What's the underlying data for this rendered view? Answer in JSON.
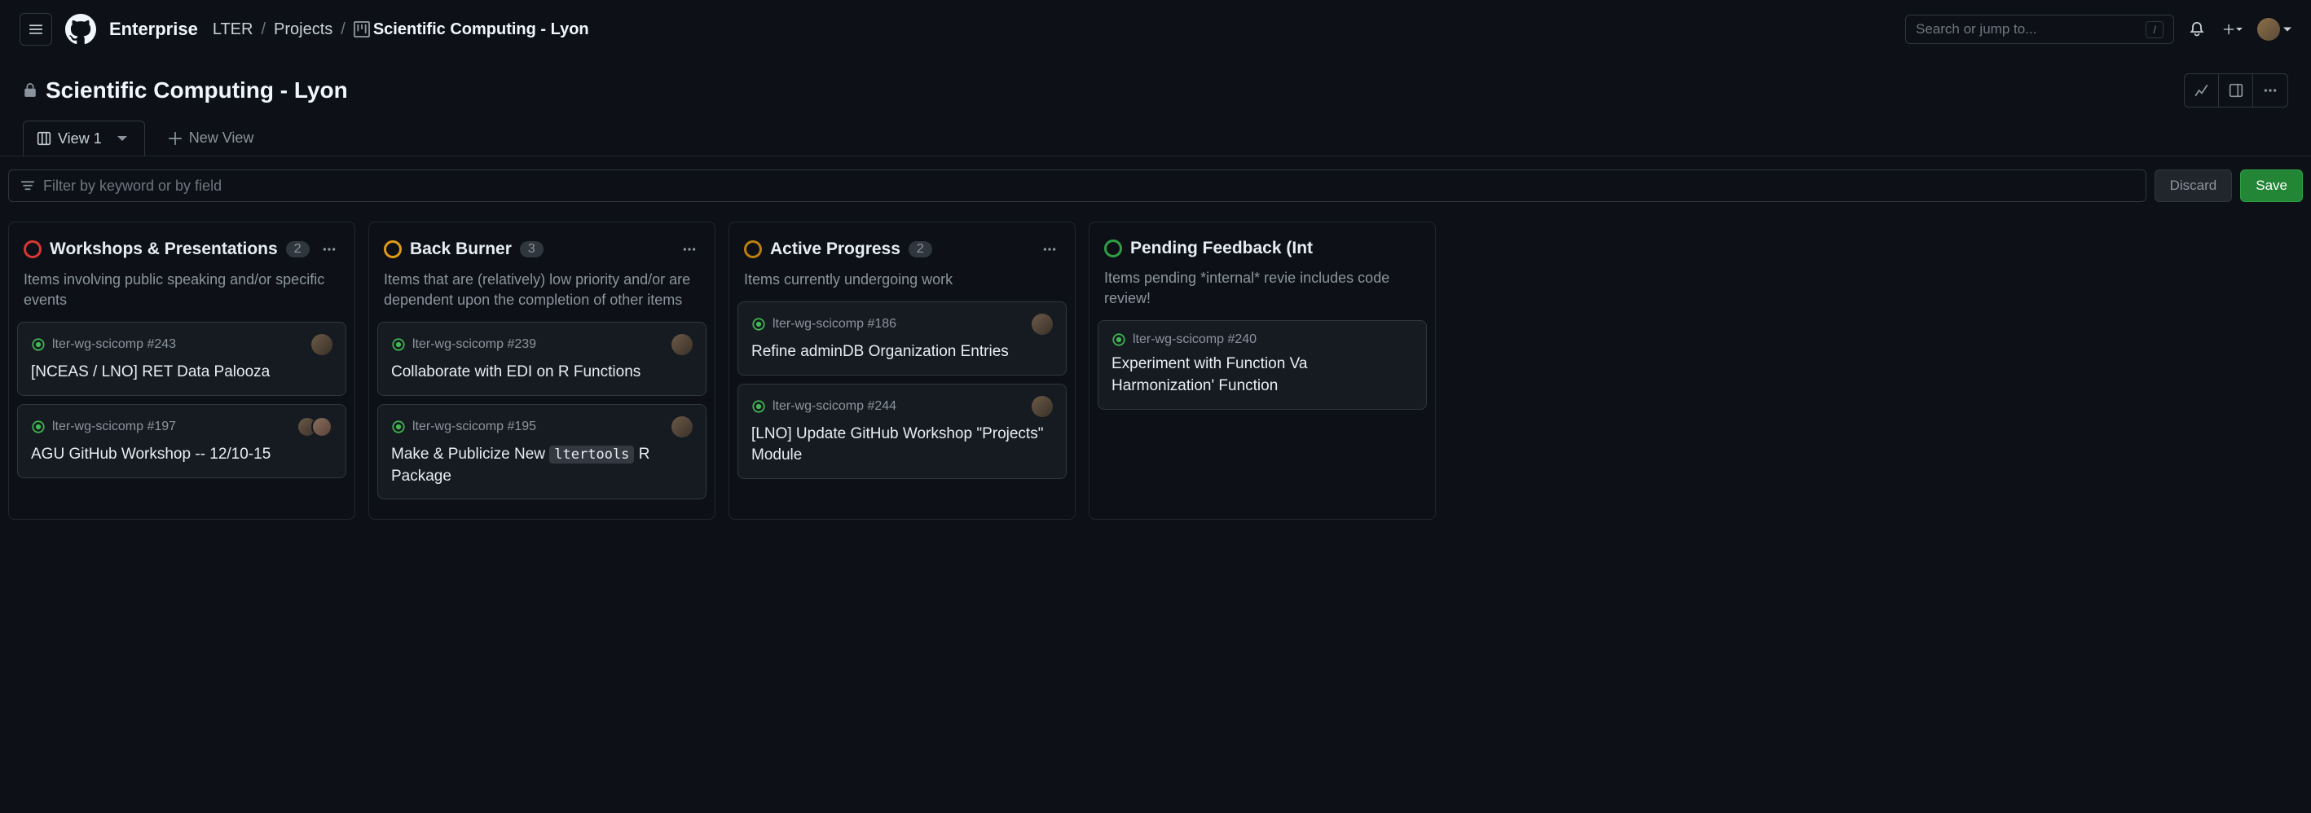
{
  "header": {
    "brand": "Enterprise",
    "breadcrumbs": {
      "org": "LTER",
      "section": "Projects",
      "current": "Scientific Computing - Lyon"
    },
    "search_placeholder": "Search or jump to...",
    "search_kbd": "/"
  },
  "project": {
    "title": "Scientific Computing - Lyon",
    "view_tab": "View 1",
    "new_view": "New View"
  },
  "filter": {
    "placeholder": "Filter by keyword or by field",
    "discard": "Discard",
    "save": "Save"
  },
  "columns": [
    {
      "color": "red",
      "title": "Workshops & Presentations",
      "count": "2",
      "desc": "Items involving public speaking and/or specific events",
      "cards": [
        {
          "ref": "lter-wg-scicomp #243",
          "title": "[NCEAS / LNO] RET Data Palooza",
          "avatars": 1
        },
        {
          "ref": "lter-wg-scicomp #197",
          "title": "AGU GitHub Workshop -- 12/10-15",
          "avatars": 2
        }
      ]
    },
    {
      "color": "orange",
      "title": "Back Burner",
      "count": "3",
      "desc": "Items that are (relatively) low priority and/or are dependent upon the completion of other items",
      "cards": [
        {
          "ref": "lter-wg-scicomp #239",
          "title": "Collaborate with EDI on R Functions",
          "avatars": 1
        },
        {
          "ref": "lter-wg-scicomp #195",
          "title_pre": "Make & Publicize New ",
          "code": "ltertools",
          "title_post": " R Package",
          "avatars": 1
        }
      ]
    },
    {
      "color": "yellow",
      "title": "Active Progress",
      "count": "2",
      "desc": "Items currently undergoing work",
      "cards": [
        {
          "ref": "lter-wg-scicomp #186",
          "title": "Refine adminDB Organization Entries",
          "avatars": 1
        },
        {
          "ref": "lter-wg-scicomp #244",
          "title": "[LNO] Update GitHub Workshop \"Projects\" Module",
          "avatars": 1
        }
      ]
    },
    {
      "color": "green",
      "title": "Pending Feedback (Int",
      "count": "",
      "desc": "Items pending *internal* revie    includes code review!",
      "cards": [
        {
          "ref": "lter-wg-scicomp #240",
          "title": "Experiment with Function Va   Harmonization' Function",
          "avatars": 0
        }
      ]
    }
  ]
}
